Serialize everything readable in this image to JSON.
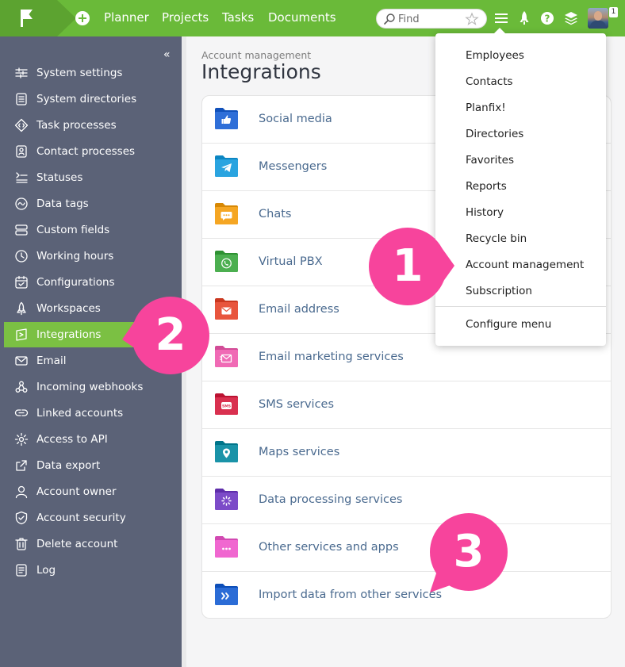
{
  "topbar": {
    "nav": [
      "Planner",
      "Projects",
      "Tasks",
      "Documents"
    ],
    "search_placeholder": "Find",
    "notification_count": "1",
    "brand_color": "#6aba39"
  },
  "sidebar": {
    "collapse_label": "«",
    "items": [
      {
        "label": "System settings",
        "icon": "sliders-icon"
      },
      {
        "label": "System directories",
        "icon": "directory-icon"
      },
      {
        "label": "Task processes",
        "icon": "diamond-code-icon"
      },
      {
        "label": "Contact processes",
        "icon": "contact-card-icon"
      },
      {
        "label": "Statuses",
        "icon": "status-list-icon"
      },
      {
        "label": "Data tags",
        "icon": "tag-wave-icon"
      },
      {
        "label": "Custom fields",
        "icon": "fields-icon"
      },
      {
        "label": "Working hours",
        "icon": "clock-icon"
      },
      {
        "label": "Configurations",
        "icon": "calendar-icon"
      },
      {
        "label": "Workspaces",
        "icon": "rocket-icon"
      },
      {
        "label": "Integrations",
        "icon": "integration-icon",
        "active": true
      },
      {
        "label": "Email",
        "icon": "envelope-icon"
      },
      {
        "label": "Incoming webhooks",
        "icon": "webhook-icon"
      },
      {
        "label": "Linked accounts",
        "icon": "link-icon"
      },
      {
        "label": "Access to API",
        "icon": "gear-icon"
      },
      {
        "label": "Data export",
        "icon": "export-icon"
      },
      {
        "label": "Account owner",
        "icon": "person-icon"
      },
      {
        "label": "Account security",
        "icon": "shield-icon"
      },
      {
        "label": "Delete account",
        "icon": "trash-icon"
      },
      {
        "label": "Log",
        "icon": "log-icon"
      }
    ],
    "active_color": "#7bc043",
    "bg_color": "#5b6277"
  },
  "main": {
    "breadcrumb": "Account management",
    "title": "Integrations",
    "integrations": [
      {
        "label": "Social media",
        "color": "#2f6fd8",
        "icon": "thumbs-up-icon"
      },
      {
        "label": "Messengers",
        "color": "#2aa4e0",
        "icon": "telegram-icon"
      },
      {
        "label": "Chats",
        "color": "#f5a623",
        "icon": "chat-bubble-icon"
      },
      {
        "label": "Virtual PBX",
        "color": "#4caf50",
        "icon": "phone-icon"
      },
      {
        "label": "Email address",
        "color": "#e8553d",
        "icon": "envelope-icon"
      },
      {
        "label": "Email marketing services",
        "color": "#f06ab5",
        "icon": "mail-marketing-icon"
      },
      {
        "label": "SMS services",
        "color": "#d9304f",
        "icon": "sms-icon"
      },
      {
        "label": "Maps services",
        "color": "#1a93a8",
        "icon": "map-pin-icon"
      },
      {
        "label": "Data processing services",
        "color": "#7c4bc8",
        "icon": "spinner-icon"
      },
      {
        "label": "Other services and apps",
        "color": "#f067d0",
        "icon": "dots-icon"
      },
      {
        "label": "Import data from other services",
        "color": "#2b6cd6",
        "icon": "import-icon"
      }
    ]
  },
  "dropdown": {
    "items": [
      "Employees",
      "Contacts",
      "Planfix!",
      "Directories",
      "Favorites",
      "Reports",
      "History",
      "Recycle bin",
      "Account management",
      "Subscription"
    ],
    "footer": "Configure menu"
  },
  "callouts": [
    "1",
    "2",
    "3"
  ],
  "callout_color": "#f7449c"
}
